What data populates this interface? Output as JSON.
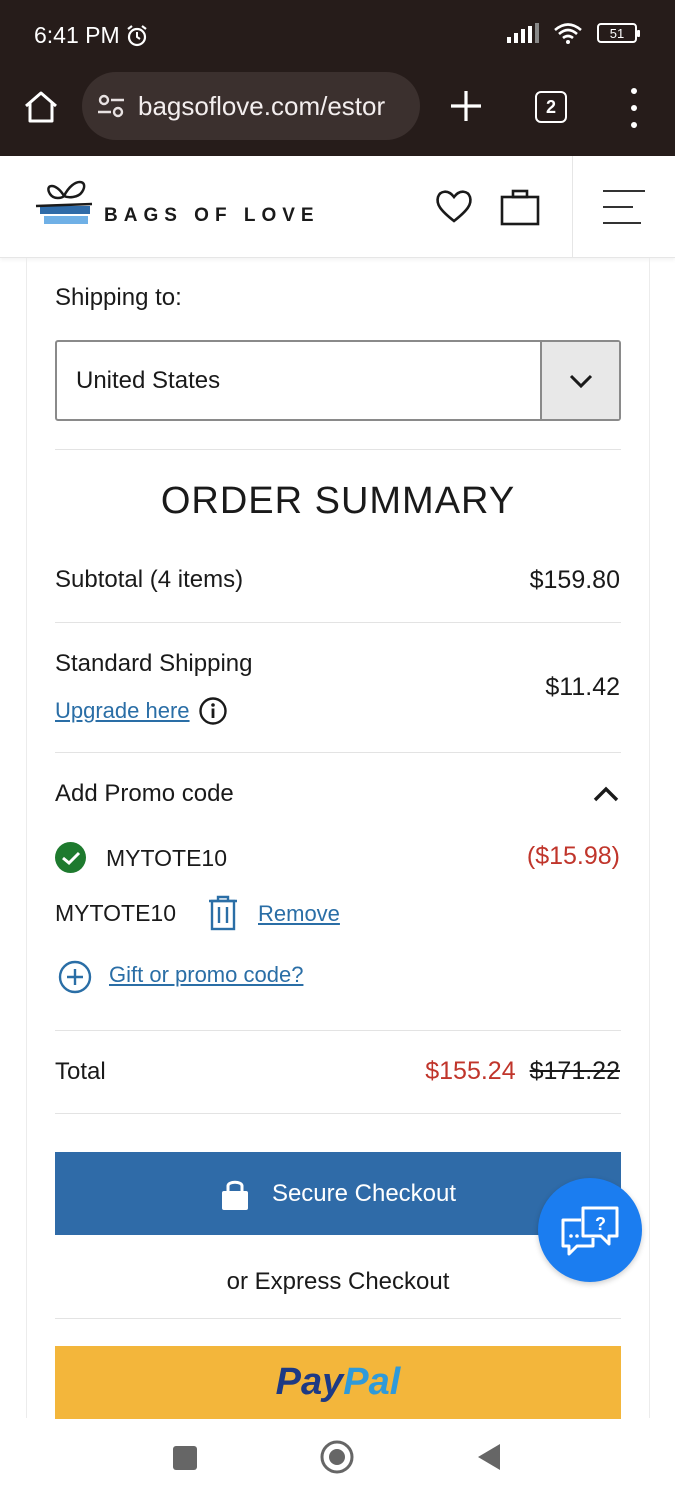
{
  "status_bar": {
    "time": "6:41 PM",
    "battery": "51"
  },
  "browser": {
    "url": "bagsoflove.com/estor",
    "tab_count": "2"
  },
  "header": {
    "brand": "BAGS OF LOVE"
  },
  "shipping": {
    "label": "Shipping to:",
    "country": "United States"
  },
  "summary": {
    "title": "ORDER SUMMARY",
    "subtotal_label": "Subtotal (4 items)",
    "subtotal_value": "$159.80",
    "shipping_label": "Standard Shipping",
    "shipping_value": "$11.42",
    "upgrade_link": "Upgrade here",
    "promo_label": "Add Promo code",
    "applied_code": "MYTOTE10",
    "discount_value": "($15.98)",
    "code_entry": "MYTOTE10",
    "remove_link": "Remove",
    "gift_link": "Gift or promo code?",
    "total_label": "Total",
    "total_value": "$155.24",
    "total_original": "$171.22"
  },
  "actions": {
    "checkout_label": "Secure Checkout",
    "express_label": "or Express Checkout",
    "paypal_part1": "Pay",
    "paypal_part2": "Pal"
  },
  "colors": {
    "accent_blue": "#2f6ba8",
    "discount_red": "#c0352b",
    "paypal_yellow": "#f3b63b",
    "success_green": "#1e7a2e"
  }
}
